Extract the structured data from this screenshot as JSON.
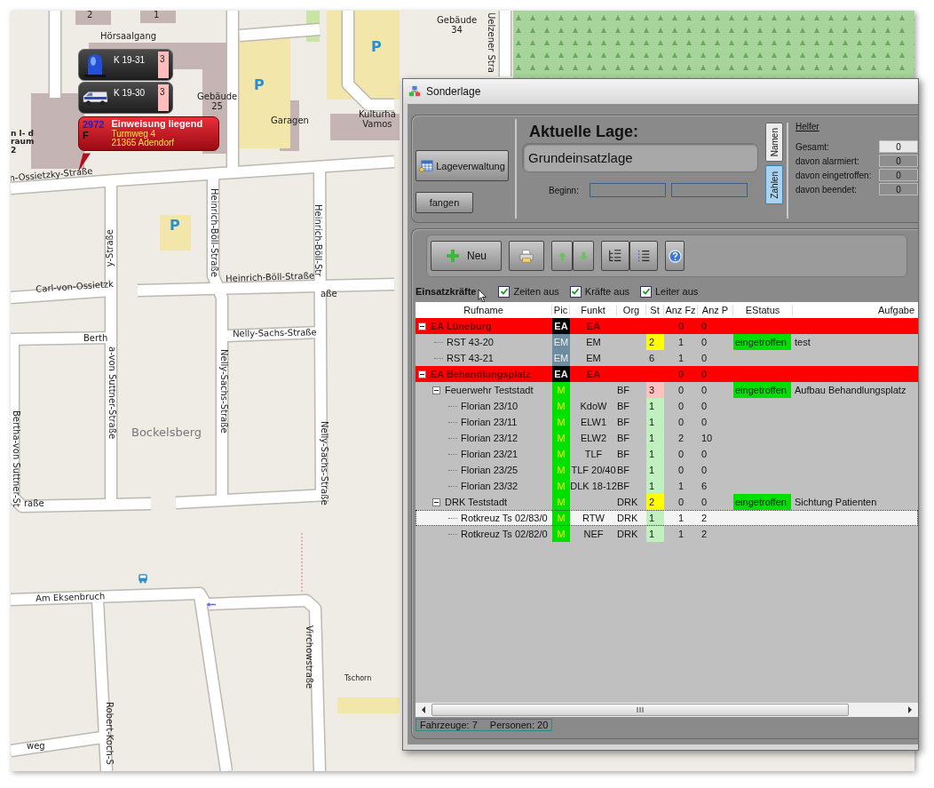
{
  "map": {
    "labels": [
      "2",
      "1",
      "Hörsaalgang",
      "Gebäude 25",
      "Garagen",
      "Kulturha Vamos",
      "Gebäude 34",
      "Uelzener Stra",
      "P",
      "P",
      "P",
      "n l- d raum 2",
      "n-Ossietzky-Straße",
      "Heinrich-Böll-Straße",
      "Heinrich-Böll-Str",
      "Carl-von-Ossietzk",
      "y-Straße",
      "Heinrich-Böll-Straße",
      "aße",
      "Berth",
      "Nelly-Sachs-Straße",
      "a-von Suttner-Straße",
      "Nelly-Sachs-Straße",
      "Bertha-von Suttner-St",
      "raße",
      "Nelly-Sachs-Straße",
      "Bockelsberg",
      "Am Eksenbruch",
      "Virchowstraße",
      "Tschorn",
      "Robert-Koch-S",
      "weg"
    ]
  },
  "units": [
    {
      "kind": "light",
      "callsign": "K 19-31",
      "count": "3"
    },
    {
      "kind": "van",
      "callsign": "K 19-30",
      "count": "3"
    }
  ],
  "incident": {
    "number": "2972",
    "type": "F",
    "title": "Einweisung liegend",
    "street": "Turmweg 4",
    "city": "21365 Adendorf"
  },
  "window": {
    "title": "Sonderlage"
  },
  "top_panel": {
    "buttons": [
      "Lageverwaltung",
      "fangen"
    ],
    "heading": "Aktuelle Lage:",
    "current_situation": "Grundeinsatzlage",
    "begin_label": "Beginn:",
    "view_toggle": [
      {
        "label": "Namen",
        "selected": false
      },
      {
        "label": "Zahlen",
        "selected": true
      }
    ],
    "helper": {
      "title": "Helfer",
      "rows": [
        {
          "label": "Gesamt:",
          "value": "0"
        },
        {
          "label": "davon alarmiert:",
          "value": "0"
        },
        {
          "label": "davon eingetroffen:",
          "value": "0"
        },
        {
          "label": "davon beendet:",
          "value": "0"
        }
      ]
    }
  },
  "toolbar": {
    "new_label": "Neu"
  },
  "filters": {
    "title": "Einsatzkräfte",
    "checkboxes": [
      {
        "label": "Zeiten aus",
        "checked": true
      },
      {
        "label": "Kräfte aus",
        "checked": true
      },
      {
        "label": "Leiter aus",
        "checked": true
      }
    ]
  },
  "table": {
    "columns": [
      "Rufname",
      "Pic",
      "Funkt",
      "Org",
      "St",
      "Anz Fz",
      "Anz P",
      "EStatus",
      "Aufgabe"
    ],
    "rows": [
      {
        "kind": "group",
        "name": "EA Lüneburg",
        "pic": {
          "text": "EA",
          "color": "#000000"
        },
        "funkt": "EA",
        "vehicles": "0",
        "persons": "0",
        "selected": false,
        "expanded": true,
        "children": [
          {
            "kind": "unit",
            "name": "RST 43-20",
            "pic": {
              "text": "EM",
              "color": "#6e8ca0"
            },
            "funkt": "EM",
            "st": {
              "text": "2",
              "color": "#ffff00"
            },
            "vehicles": "1",
            "persons": "0",
            "estatus": {
              "text": "eingetroffen",
              "color": "#00e000"
            },
            "task": "test",
            "selected": false
          },
          {
            "kind": "unit",
            "name": "RST 43-21",
            "pic": {
              "text": "EM",
              "color": "#6e8ca0"
            },
            "funkt": "EM",
            "st": {
              "text": "6"
            },
            "vehicles": "1",
            "persons": "0",
            "selected": false
          }
        ]
      },
      {
        "kind": "group",
        "name": "EA Behandlungsplatz",
        "pic": {
          "text": "EA",
          "color": "#000000"
        },
        "funkt": "EA",
        "vehicles": "0",
        "persons": "0",
        "selected": false,
        "expanded": true,
        "children": [
          {
            "kind": "unit",
            "name": "Feuerwehr Teststadt",
            "pic": {
              "text": "M",
              "color": "#00e000"
            },
            "org": "BF",
            "st": {
              "text": "3",
              "color": "#ffc0c0"
            },
            "vehicles": "0",
            "persons": "0",
            "estatus": {
              "text": "eingetroffen",
              "color": "#00e000"
            },
            "task": "Aufbau Behandlungsplatz",
            "selected": false,
            "expanded": true,
            "children": [
              {
                "kind": "unit",
                "name": "Florian 23/10",
                "pic": {
                  "text": "M",
                  "color": "#00e000"
                },
                "funkt": "KdoW",
                "org": "BF",
                "st": {
                  "text": "1",
                  "color": "#c0f0c0"
                },
                "vehicles": "0",
                "persons": "0",
                "selected": false
              },
              {
                "kind": "unit",
                "name": "Florian 23/11",
                "pic": {
                  "text": "M",
                  "color": "#00e000"
                },
                "funkt": "ELW1",
                "org": "BF",
                "st": {
                  "text": "1",
                  "color": "#c0f0c0"
                },
                "vehicles": "0",
                "persons": "0",
                "selected": false
              },
              {
                "kind": "unit",
                "name": "Florian 23/12",
                "pic": {
                  "text": "M",
                  "color": "#00e000"
                },
                "funkt": "ELW2",
                "org": "BF",
                "st": {
                  "text": "1",
                  "color": "#c0f0c0"
                },
                "vehicles": "2",
                "persons": "10",
                "selected": false
              },
              {
                "kind": "unit",
                "name": "Florian 23/21",
                "pic": {
                  "text": "M",
                  "color": "#00e000"
                },
                "funkt": "TLF",
                "org": "BF",
                "st": {
                  "text": "1",
                  "color": "#c0f0c0"
                },
                "vehicles": "0",
                "persons": "0",
                "selected": false
              },
              {
                "kind": "unit",
                "name": "Florian 23/25",
                "pic": {
                  "text": "M",
                  "color": "#00e000"
                },
                "funkt": "TLF 20/40",
                "org": "BF",
                "st": {
                  "text": "1",
                  "color": "#c0f0c0"
                },
                "vehicles": "0",
                "persons": "0",
                "selected": false
              },
              {
                "kind": "unit",
                "name": "Florian 23/32",
                "pic": {
                  "text": "M",
                  "color": "#00e000"
                },
                "funkt": "DLK 18-12",
                "org": "BF",
                "st": {
                  "text": "1",
                  "color": "#c0f0c0"
                },
                "vehicles": "1",
                "persons": "6",
                "selected": false
              }
            ]
          },
          {
            "kind": "unit",
            "name": "DRK Teststadt",
            "pic": {
              "text": "M",
              "color": "#00e000"
            },
            "org": "DRK",
            "st": {
              "text": "2",
              "color": "#ffff00"
            },
            "vehicles": "0",
            "persons": "0",
            "estatus": {
              "text": "eingetroffen",
              "color": "#00e000"
            },
            "task": "Sichtung Patienten",
            "selected": false,
            "expanded": true,
            "children": [
              {
                "kind": "unit",
                "name": "Rotkreuz Ts 02/83/0",
                "pic": {
                  "text": "M",
                  "color": "#00e000"
                },
                "funkt": "RTW",
                "org": "DRK",
                "st": {
                  "text": "1",
                  "color": "#c0f0c0"
                },
                "vehicles": "1",
                "persons": "2",
                "selected": true
              },
              {
                "kind": "unit",
                "name": "Rotkreuz Ts 02/82/0",
                "pic": {
                  "text": "M",
                  "color": "#00e000"
                },
                "funkt": "NEF",
                "org": "DRK",
                "st": {
                  "text": "1",
                  "color": "#c0f0c0"
                },
                "vehicles": "1",
                "persons": "2",
                "selected": false
              }
            ]
          }
        ]
      }
    ]
  },
  "status_bar": [
    "Fahrzeuge: 7",
    "Personen: 20"
  ]
}
